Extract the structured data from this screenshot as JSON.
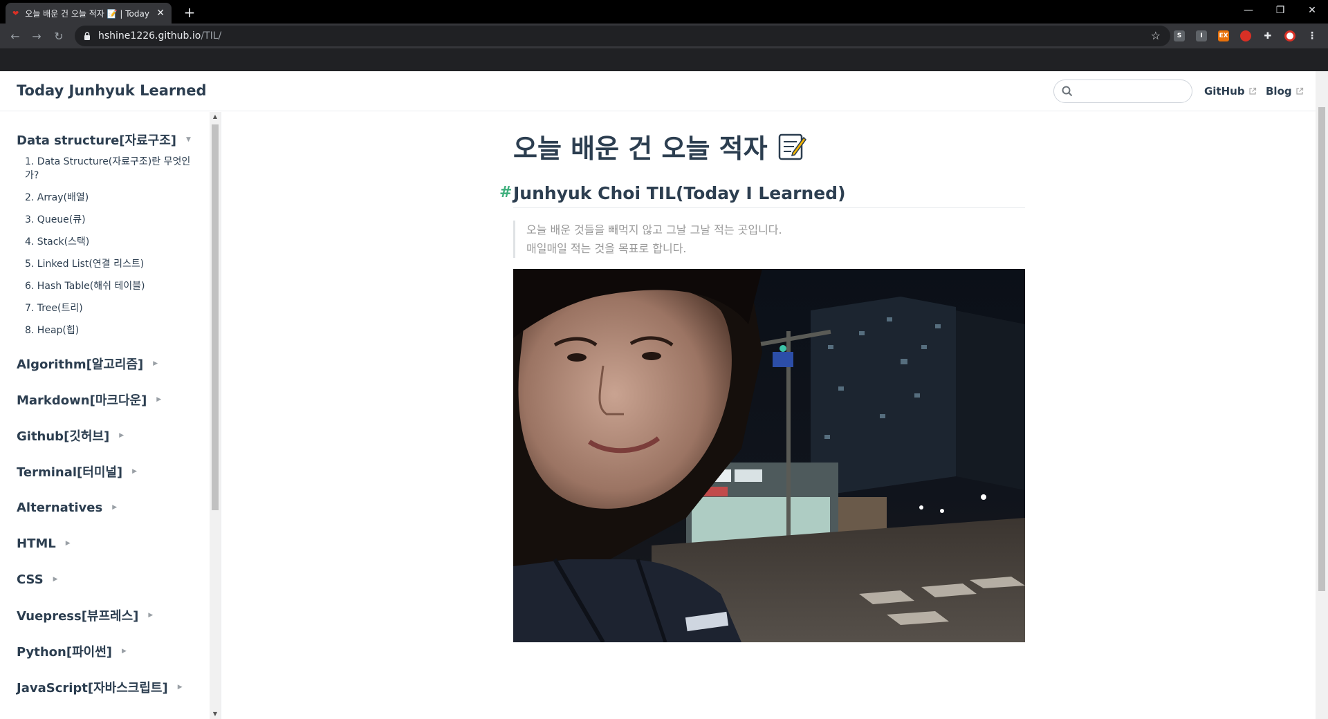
{
  "browser": {
    "tab_title": "오늘 배운 건 오늘 적자 📝 | Today Junhyuk Learned",
    "url_host": "hshine1226.github.io",
    "url_path": "/TIL/",
    "extensions": [
      {
        "label": "S",
        "color": "#5f6368"
      },
      {
        "label": "I",
        "color": "#5f6368"
      },
      {
        "label": "EX",
        "color": "#e8710a"
      },
      {
        "label": "",
        "color": "#d93025"
      }
    ]
  },
  "navbar": {
    "site_name": "Today Junhyuk Learned",
    "search_placeholder": "",
    "links": [
      "GitHub",
      "Blog"
    ]
  },
  "sidebar": {
    "open_group": {
      "title": "Data structure[자료구조]",
      "items": [
        "1. Data Structure(자료구조)란 무엇인가?",
        "2. Array(배열)",
        "3. Queue(큐)",
        "4. Stack(스택)",
        "5. Linked List(연결 리스트)",
        "6. Hash Table(해쉬 테이블)",
        "7. Tree(트리)",
        "8. Heap(힙)"
      ]
    },
    "groups": [
      "Algorithm[알고리즘]",
      "Markdown[마크다운]",
      "Github[깃허브]",
      "Terminal[터미널]",
      "Alternatives",
      "HTML",
      "CSS",
      "Vuepress[뷰프레스]",
      "Python[파이썬]",
      "JavaScript[자바스크립트]"
    ]
  },
  "content": {
    "title": "오늘 배운 건 오늘 적자",
    "heading": "Junhyuk Choi TIL(Today I Learned)",
    "heading_anchor": "#",
    "quote_lines": [
      "오늘 배운 것들을 빼먹지 않고 그날 그날 적는 곳입니다.",
      "매일매일 적는 것을 목표로 합니다."
    ]
  },
  "colors": {
    "accent": "#3eaf7c",
    "text": "#2c3e50"
  }
}
